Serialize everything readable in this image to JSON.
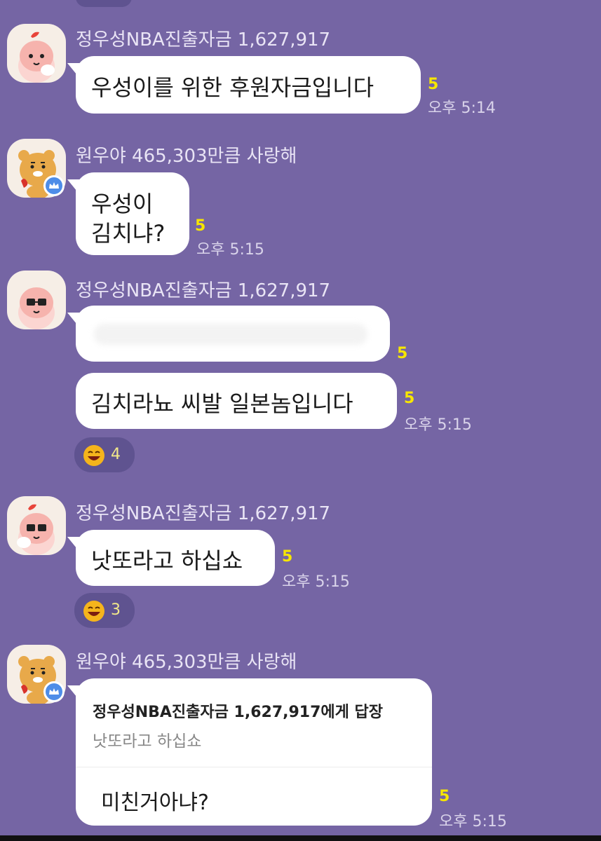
{
  "messages": [
    {
      "sender": "정우성NBA진출자금 1,627,917",
      "text": "우성이를 위한 후원자금입니다",
      "unread": "5",
      "time": "오후 5:14"
    },
    {
      "sender": "원우야 465,303만큼 사랑해",
      "line1": "우성이",
      "line2": "김치냐?",
      "unread": "5",
      "time": "오후 5:15"
    },
    {
      "sender": "정우성NBA진출자금 1,627,917",
      "unread_hidden": "5"
    },
    {
      "text": "김치라뇨 씨발 일본놈입니다",
      "unread": "5",
      "time": "오후 5:15",
      "reaction_count": "4"
    },
    {
      "sender": "정우성NBA진출자금 1,627,917",
      "text": "낫또라고 하십쇼",
      "unread": "5",
      "time": "오후 5:15",
      "reaction_count": "3"
    },
    {
      "sender": "원우야 465,303만큼 사랑해",
      "reply_to": "정우성NBA진출자금 1,627,917에게 답장",
      "reply_quote": "낫또라고 하십쇼",
      "text": "미친거아냐?",
      "unread": "5",
      "time": "오후 5:15"
    }
  ],
  "colors": {
    "background": "#7565a4",
    "unread": "#f7e600",
    "bubble": "#ffffff"
  },
  "icons": {
    "avatar_peach": "apeach-avatar-icon",
    "avatar_lion": "ryan-avatar-icon",
    "crown": "crown-badge-icon",
    "emoji": "laughing-emoji-icon"
  }
}
